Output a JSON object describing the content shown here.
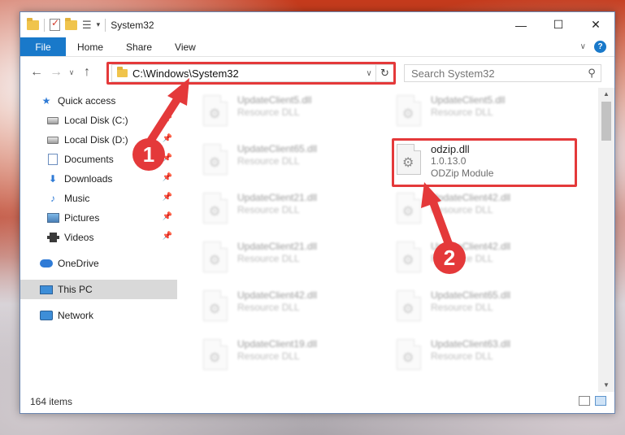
{
  "window": {
    "title": "System32",
    "controls": [
      "minimize-icon",
      "maximize-icon",
      "close-icon"
    ]
  },
  "ribbon": {
    "file_label": "File",
    "tabs": [
      "Home",
      "Share",
      "View"
    ]
  },
  "address": {
    "path": "C:\\Windows\\System32",
    "search_placeholder": "Search System32"
  },
  "sidebar": {
    "items": [
      {
        "label": "Quick access",
        "icon": "star-icon"
      },
      {
        "label": "Local Disk (C:)",
        "icon": "drive-icon",
        "pinned": true
      },
      {
        "label": "Local Disk (D:)",
        "icon": "drive-icon",
        "pinned": true
      },
      {
        "label": "Documents",
        "icon": "documents-icon",
        "pinned": true
      },
      {
        "label": "Downloads",
        "icon": "downloads-icon",
        "pinned": true
      },
      {
        "label": "Music",
        "icon": "music-icon",
        "pinned": true
      },
      {
        "label": "Pictures",
        "icon": "pictures-icon",
        "pinned": true
      },
      {
        "label": "Videos",
        "icon": "videos-icon",
        "pinned": true
      },
      {
        "label": "OneDrive",
        "icon": "cloud-icon"
      },
      {
        "label": "This PC",
        "icon": "computer-icon",
        "selected": true
      },
      {
        "label": "Network",
        "icon": "network-icon"
      }
    ]
  },
  "files": {
    "left": [
      {
        "name": "UpdateClient5.dll",
        "desc": "Resource DLL"
      },
      {
        "name": "UpdateClient65.dll",
        "desc": "Resource DLL"
      },
      {
        "name": "UpdateClient21.dll",
        "desc": "Resource DLL"
      },
      {
        "name": "UpdateClient21.dll",
        "desc": "Resource DLL"
      },
      {
        "name": "UpdateClient42.dll",
        "desc": "Resource DLL"
      },
      {
        "name": "UpdateClient19.dll",
        "desc": "Resource DLL"
      }
    ],
    "right": [
      {
        "name": "UpdateClient5.dll",
        "desc": "Resource DLL"
      },
      {
        "name": "UpdateClient42.dll",
        "desc": "Resource DLL"
      },
      {
        "name": "UpdateClient42.dll",
        "desc": "Resource DLL"
      },
      {
        "name": "UpdateClient65.dll",
        "desc": "Resource DLL"
      },
      {
        "name": "UpdateClient63.dll",
        "desc": "Resource DLL"
      }
    ],
    "highlighted": {
      "name": "odzip.dll",
      "version": "1.0.13.0",
      "desc": "ODZip Module"
    }
  },
  "status": {
    "count": "164 items"
  },
  "annotations": {
    "step1": "1",
    "step2": "2",
    "color": "#e4393a"
  }
}
